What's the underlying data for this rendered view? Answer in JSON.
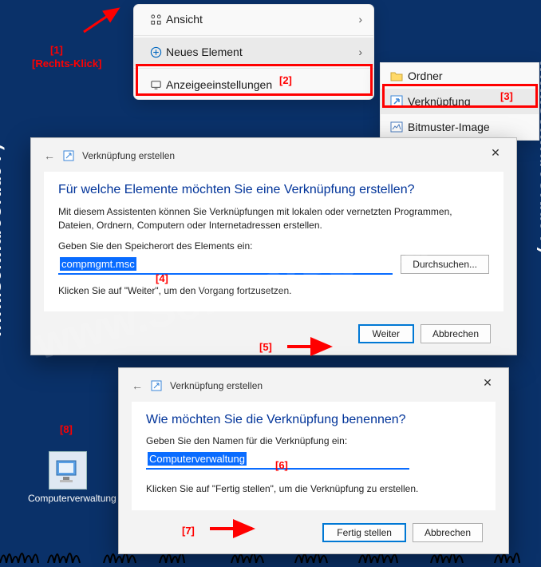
{
  "watermark": "www.SoftwareOK.de :-)",
  "annotations": {
    "a1": "[1]",
    "a1_label": "[Rechts-Klick]",
    "a2": "[2]",
    "a3": "[3]",
    "a4": "[4]",
    "a5": "[5]",
    "a6": "[6]",
    "a7": "[7]",
    "a8": "[8]"
  },
  "context_menu": {
    "ansicht": "Ansicht",
    "neues_element": "Neues Element",
    "anzeigeeinstellungen": "Anzeigeeinstellungen"
  },
  "submenu": {
    "ordner": "Ordner",
    "verknuepfung": "Verknüpfung",
    "bitmuster": "Bitmuster-Image"
  },
  "dialog1": {
    "header": "Verknüpfung erstellen",
    "title": "Für welche Elemente möchten Sie eine Verknüpfung erstellen?",
    "desc": "Mit diesem Assistenten können Sie Verknüpfungen mit lokalen oder vernetzten Programmen, Dateien, Ordnern, Computern oder Internetadressen erstellen.",
    "label": "Geben Sie den Speicherort des Elements ein:",
    "value": "compmgmt.msc",
    "browse": "Durchsuchen...",
    "hint": "Klicken Sie auf \"Weiter\", um den Vorgang fortzusetzen.",
    "next": "Weiter",
    "cancel": "Abbrechen"
  },
  "dialog2": {
    "header": "Verknüpfung erstellen",
    "title": "Wie möchten Sie die Verknüpfung benennen?",
    "label": "Geben Sie den Namen für die Verknüpfung ein:",
    "value": "Computerverwaltung",
    "hint": "Klicken Sie auf \"Fertig stellen\", um die Verknüpfung zu erstellen.",
    "finish": "Fertig stellen",
    "cancel": "Abbrechen"
  },
  "desktop_icon": {
    "label": "Computerverwaltung"
  }
}
